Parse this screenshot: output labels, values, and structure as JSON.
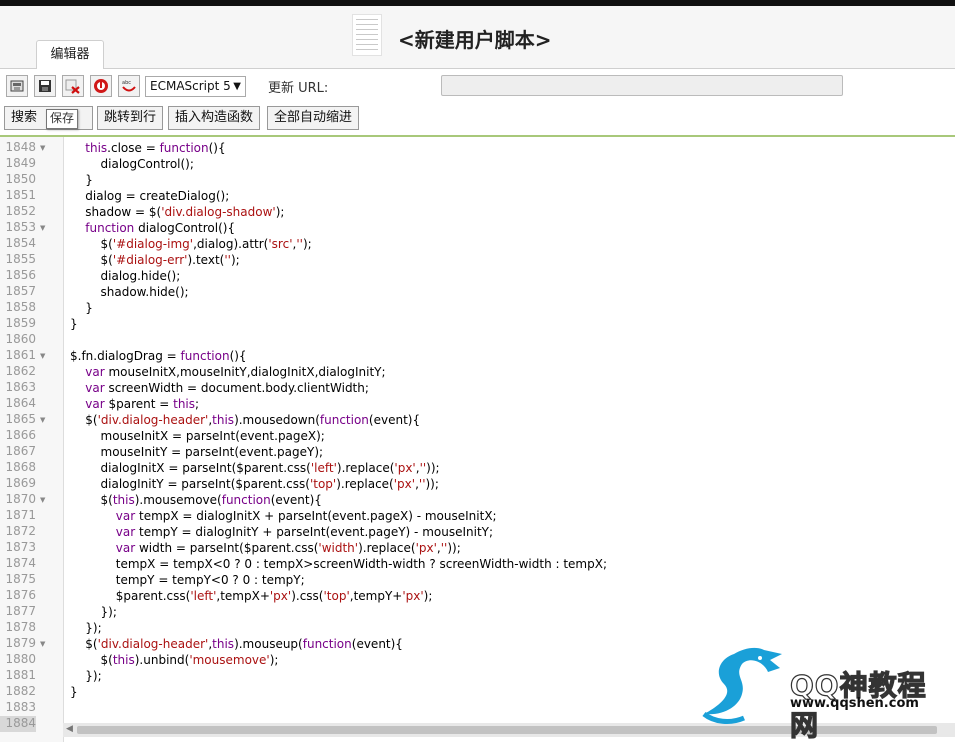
{
  "header": {
    "title": "<新建用户脚本>"
  },
  "tabs": [
    {
      "label": "编辑器"
    }
  ],
  "toolbar": {
    "language": "ECMAScript 5",
    "update_url_label": "更新 URL:",
    "update_url_value": "",
    "buttons": [
      "搜索",
      "跳转到行",
      "插入构造函数",
      "全部自动缩进"
    ],
    "tooltip": "保存"
  },
  "editor": {
    "lines": [
      {
        "n": "1848",
        "fold": true,
        "text": "    this.close = function(){"
      },
      {
        "n": "1849",
        "fold": false,
        "text": "        dialogControl();"
      },
      {
        "n": "1850",
        "fold": false,
        "text": "    }"
      },
      {
        "n": "1851",
        "fold": false,
        "text": "    dialog = createDialog();"
      },
      {
        "n": "1852",
        "fold": false,
        "text": "    shadow = $('div.dialog-shadow');"
      },
      {
        "n": "1853",
        "fold": true,
        "text": "    function dialogControl(){"
      },
      {
        "n": "1854",
        "fold": false,
        "text": "        $('#dialog-img',dialog).attr('src','');"
      },
      {
        "n": "1855",
        "fold": false,
        "text": "        $('#dialog-err').text('');"
      },
      {
        "n": "1856",
        "fold": false,
        "text": "        dialog.hide();"
      },
      {
        "n": "1857",
        "fold": false,
        "text": "        shadow.hide();"
      },
      {
        "n": "1858",
        "fold": false,
        "text": "    }"
      },
      {
        "n": "1859",
        "fold": false,
        "text": "}"
      },
      {
        "n": "1860",
        "fold": false,
        "text": ""
      },
      {
        "n": "1861",
        "fold": true,
        "text": "$.fn.dialogDrag = function(){"
      },
      {
        "n": "1862",
        "fold": false,
        "text": "    var mouseInitX,mouseInitY,dialogInitX,dialogInitY;"
      },
      {
        "n": "1863",
        "fold": false,
        "text": "    var screenWidth = document.body.clientWidth;"
      },
      {
        "n": "1864",
        "fold": false,
        "text": "    var $parent = this;"
      },
      {
        "n": "1865",
        "fold": true,
        "text": "    $('div.dialog-header',this).mousedown(function(event){"
      },
      {
        "n": "1866",
        "fold": false,
        "text": "        mouseInitX = parseInt(event.pageX);"
      },
      {
        "n": "1867",
        "fold": false,
        "text": "        mouseInitY = parseInt(event.pageY);"
      },
      {
        "n": "1868",
        "fold": false,
        "text": "        dialogInitX = parseInt($parent.css('left').replace('px',''));"
      },
      {
        "n": "1869",
        "fold": false,
        "text": "        dialogInitY = parseInt($parent.css('top').replace('px',''));"
      },
      {
        "n": "1870",
        "fold": true,
        "text": "        $(this).mousemove(function(event){"
      },
      {
        "n": "1871",
        "fold": false,
        "text": "            var tempX = dialogInitX + parseInt(event.pageX) - mouseInitX;"
      },
      {
        "n": "1872",
        "fold": false,
        "text": "            var tempY = dialogInitY + parseInt(event.pageY) - mouseInitY;"
      },
      {
        "n": "1873",
        "fold": false,
        "text": "            var width = parseInt($parent.css('width').replace('px',''));"
      },
      {
        "n": "1874",
        "fold": false,
        "text": "            tempX = tempX<0 ? 0 : tempX>screenWidth-width ? screenWidth-width : tempX;"
      },
      {
        "n": "1875",
        "fold": false,
        "text": "            tempY = tempY<0 ? 0 : tempY;"
      },
      {
        "n": "1876",
        "fold": false,
        "text": "            $parent.css('left',tempX+'px').css('top',tempY+'px');"
      },
      {
        "n": "1877",
        "fold": false,
        "text": "        });"
      },
      {
        "n": "1878",
        "fold": false,
        "text": "    });"
      },
      {
        "n": "1879",
        "fold": true,
        "text": "    $('div.dialog-header',this).mouseup(function(event){"
      },
      {
        "n": "1880",
        "fold": false,
        "text": "        $(this).unbind('mousemove');"
      },
      {
        "n": "1881",
        "fold": false,
        "text": "    });"
      },
      {
        "n": "1882",
        "fold": false,
        "text": "}"
      },
      {
        "n": "1883",
        "fold": false,
        "text": ""
      },
      {
        "n": "1884",
        "fold": false,
        "text": ""
      }
    ],
    "current_line": "1884"
  },
  "watermark": {
    "brand": "QQ神教程网",
    "url": "www.qqshen.com",
    "color": "#1aa0d8"
  }
}
